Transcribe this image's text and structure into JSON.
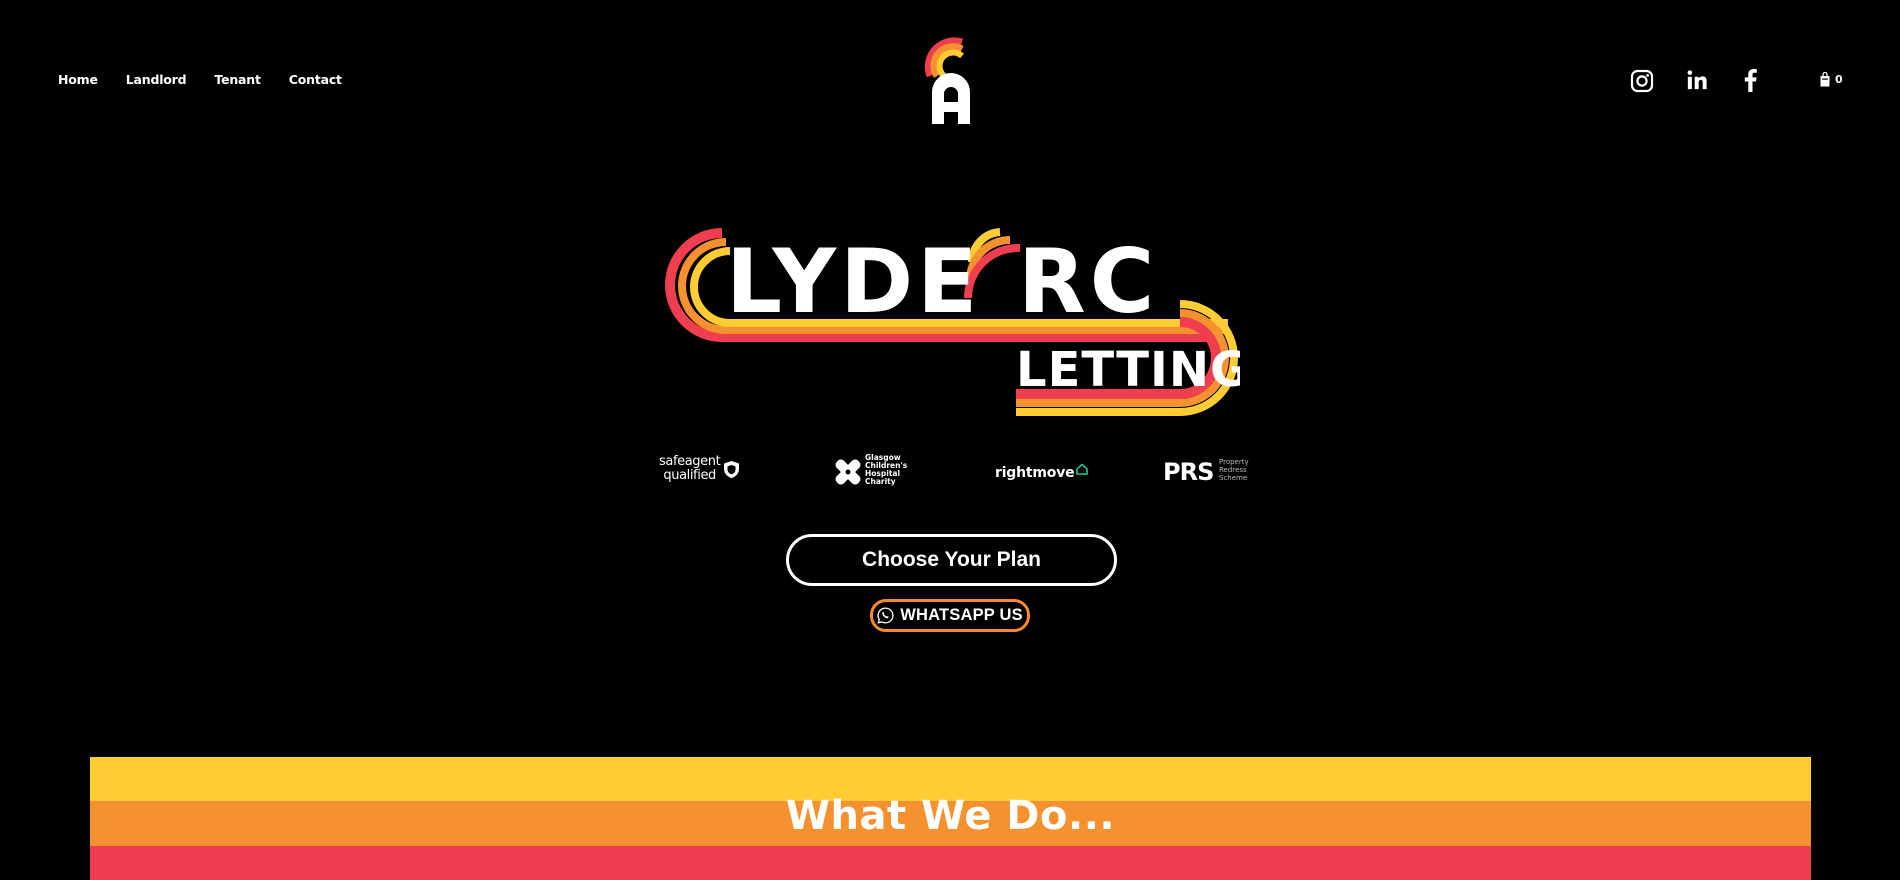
{
  "nav": {
    "items": [
      {
        "label": "Home"
      },
      {
        "label": "Landlord"
      },
      {
        "label": "Tenant"
      },
      {
        "label": "Contact"
      }
    ]
  },
  "header": {
    "logo_icon": "ca-monogram-logo",
    "social": [
      {
        "icon": "instagram-icon"
      },
      {
        "icon": "linkedin-icon"
      },
      {
        "icon": "facebook-icon"
      }
    ],
    "cart_count": "0"
  },
  "hero": {
    "logo_lines": [
      "LYDE",
      "RC",
      "LETTING"
    ],
    "partners": {
      "safeagent_line1": "safeagent",
      "safeagent_line2": "qualified",
      "glasgow": "Glasgow Children's Hospital Charity",
      "rightmove": "rightmove",
      "prs_big": "PRS",
      "prs_small": "Property Redress Scheme"
    },
    "plan_button": "Choose Your Plan",
    "whatsapp_button": "WHATSAPP US"
  },
  "section": {
    "title": "What We Do..."
  },
  "colors": {
    "yellow": "#fecc33",
    "orange": "#f6912f",
    "red": "#ef3e4f",
    "background": "#000000"
  }
}
